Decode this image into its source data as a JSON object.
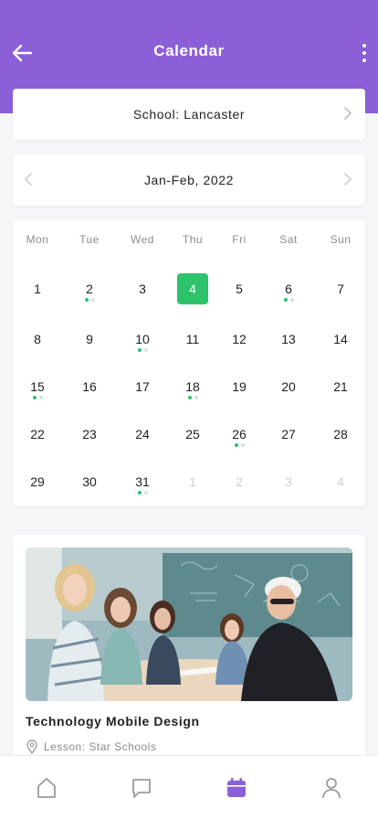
{
  "header": {
    "title": "Calendar"
  },
  "school": {
    "label": "School: Lancaster"
  },
  "month": {
    "label": "Jan-Feb, 2022"
  },
  "calendar": {
    "weekdays": [
      "Mon",
      "Tue",
      "Wed",
      "Thu",
      "Fri",
      "Sat",
      "Sun"
    ],
    "selected": "4",
    "rows": [
      [
        "1",
        "2",
        "3",
        "4",
        "5",
        "6",
        "7"
      ],
      [
        "8",
        "9",
        "10",
        "11",
        "12",
        "13",
        "14"
      ],
      [
        "15",
        "16",
        "17",
        "18",
        "19",
        "20",
        "21"
      ],
      [
        "22",
        "23",
        "24",
        "25",
        "26",
        "27",
        "28"
      ],
      [
        "29",
        "30",
        "31",
        "1",
        "2",
        "3",
        "4"
      ]
    ],
    "event_days": [
      "2",
      "6",
      "10",
      "15",
      "18",
      "26",
      "31"
    ],
    "next_month_days": [
      "1",
      "2",
      "3",
      "4"
    ]
  },
  "lesson": {
    "title": "Technology Mobile Design",
    "subtitle": "Lesson: Star Schools"
  },
  "colors": {
    "header": "#8b5fd6",
    "accent_purple": "#8b5fd6",
    "selected_day": "#2dc26b",
    "event_dot": "#2dc26b"
  },
  "icons": {
    "back": "arrow-left-icon",
    "more": "kebab-menu-icon",
    "chevron_left": "chevron-left-icon",
    "chevron_right": "chevron-right-icon",
    "location": "location-pin-icon",
    "tabs": [
      "home-icon",
      "chat-icon",
      "calendar-icon",
      "profile-icon"
    ]
  }
}
